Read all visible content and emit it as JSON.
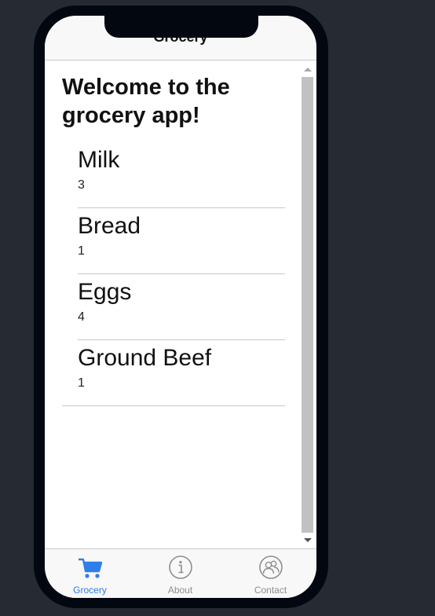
{
  "nav": {
    "title": "Grocery"
  },
  "main": {
    "heading": "Welcome to the grocery app!"
  },
  "items": [
    {
      "name": "Milk",
      "qty": "3"
    },
    {
      "name": "Bread",
      "qty": "1"
    },
    {
      "name": "Eggs",
      "qty": "4"
    },
    {
      "name": "Ground Beef",
      "qty": "1"
    }
  ],
  "tabs": [
    {
      "label": "Grocery",
      "icon": "cart-icon",
      "active": true
    },
    {
      "label": "About",
      "icon": "info-icon",
      "active": false
    },
    {
      "label": "Contact",
      "icon": "contacts-icon",
      "active": false
    }
  ],
  "colors": {
    "accent": "#2f7ee9",
    "inactive": "#8e8e8e",
    "background": "#252a33",
    "bezel": "#030810"
  }
}
